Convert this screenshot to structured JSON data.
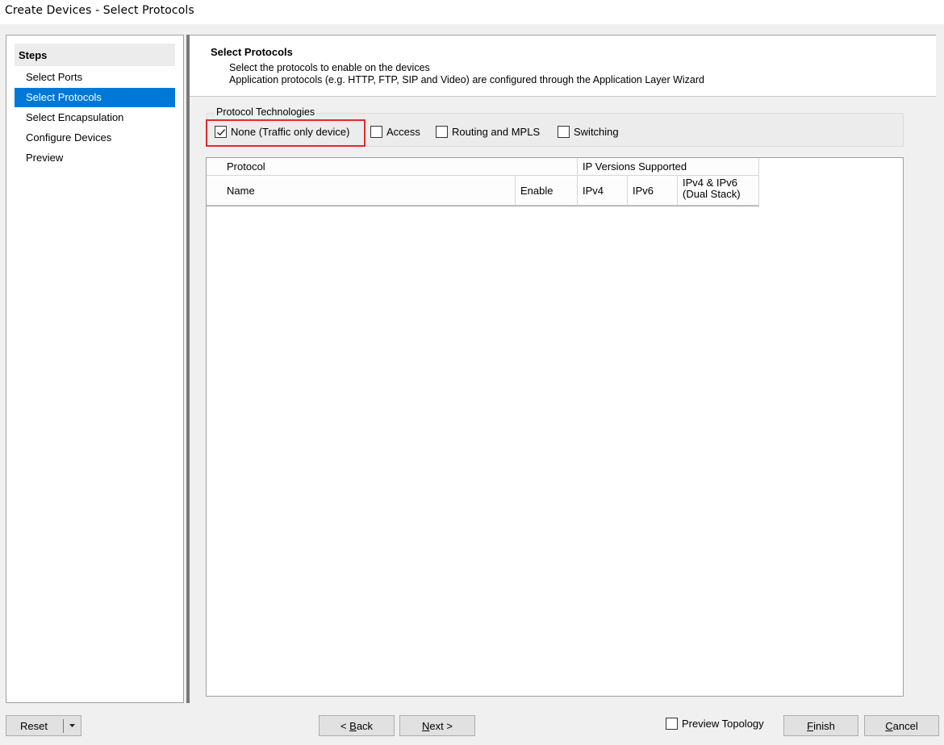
{
  "window": {
    "title": "Create Devices - Select Protocols"
  },
  "steps": {
    "header": "Steps",
    "items": [
      {
        "label": "Select Ports",
        "selected": false
      },
      {
        "label": "Select Protocols",
        "selected": true
      },
      {
        "label": "Select Encapsulation",
        "selected": false
      },
      {
        "label": "Configure Devices",
        "selected": false
      },
      {
        "label": "Preview",
        "selected": false
      }
    ]
  },
  "header": {
    "title": "Select Protocols",
    "line1": "Select the protocols to enable on the devices",
    "line2": "Application protocols (e.g. HTTP, FTP, SIP and Video) are configured through the Application Layer Wizard"
  },
  "protocol_technologies": {
    "label": "Protocol Technologies",
    "options": [
      {
        "label": "None (Traffic only device)",
        "checked": true
      },
      {
        "label": "Access",
        "checked": false
      },
      {
        "label": "Routing and MPLS",
        "checked": false
      },
      {
        "label": "Switching",
        "checked": false
      }
    ]
  },
  "table": {
    "group_protocol": "Protocol",
    "group_ip": "IP Versions Supported",
    "columns": {
      "name": "Name",
      "enable": "Enable",
      "ipv4": "IPv4",
      "ipv6": "IPv6",
      "dual_line1": "IPv4 & IPv6",
      "dual_line2": "(Dual Stack)"
    },
    "rows": []
  },
  "footer": {
    "reset": "Reset",
    "back_prefix": "< ",
    "back_hot": "B",
    "back_rest": "ack",
    "next_hot": "N",
    "next_rest": "ext >",
    "preview_topology": {
      "label": "Preview Topology",
      "checked": false
    },
    "finish_hot": "F",
    "finish_rest": "inish",
    "cancel_hot": "C",
    "cancel_rest": "ancel"
  },
  "colors": {
    "selection": "#0078d7",
    "highlight_box": "#e32a2a"
  },
  "icons": {
    "check": "check-icon",
    "dropdown": "small-down-arrow-icon"
  }
}
